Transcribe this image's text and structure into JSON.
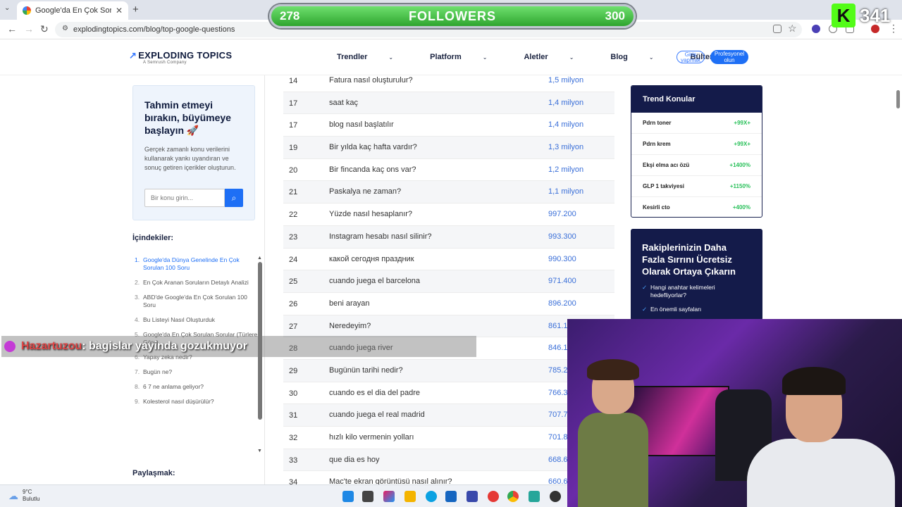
{
  "browser": {
    "tab_title": "Google'da En Çok Sorulan 100",
    "url": "explodingtopics.com/blog/top-google-questions"
  },
  "overlay": {
    "followers_current": "278",
    "followers_label": "FOLLOWERS",
    "followers_goal": "300",
    "kick_logo": "K",
    "kick_count": "341"
  },
  "site": {
    "logo": "EXPLODING TOPICS",
    "logo_sub": "A Semrush Company",
    "nav": [
      "Trendler",
      "Platform",
      "Aletler",
      "Blog",
      "Bülten"
    ],
    "login": "Giriş yapmak",
    "pro": "Profesyonel olun"
  },
  "promo": {
    "title": "Tahmin etmeyi bırakın, büyümeye başlayın 🚀",
    "text": "Gerçek zamanlı konu verilerini kullanarak yankı uyandıran ve sonuç getiren içerikler oluşturun.",
    "search_placeholder": "Bir konu girin..."
  },
  "toc": {
    "title": "İçindekiler:",
    "items": [
      {
        "num": "1.",
        "label": "Google'da Dünya Genelinde En Çok Sorulan 100 Soru"
      },
      {
        "num": "2.",
        "label": "En Çok Aranan Soruların Detaylı Analizi"
      },
      {
        "num": "3.",
        "label": "ABD'de Google'da En Çok Sorulan 100 Soru"
      },
      {
        "num": "4.",
        "label": "Bu Listeyi Nasıl Oluşturduk"
      },
      {
        "num": "5.",
        "label": "Google'da En Çok Sorulan Sorular (Türlere Göre)"
      },
      {
        "num": "6.",
        "label": "Yapay zeka nedir?"
      },
      {
        "num": "7.",
        "label": "Bugün ne?"
      },
      {
        "num": "8.",
        "label": "6 7 ne anlama geliyor?"
      },
      {
        "num": "9.",
        "label": "Kolesterol nasıl düşürülür?"
      }
    ],
    "share": "Paylaşmak:"
  },
  "table": {
    "rows": [
      {
        "rank": "14",
        "q": "Fatura nasıl oluşturulur?",
        "v": "1,5 milyon"
      },
      {
        "rank": "17",
        "q": "saat kaç",
        "v": "1,4 milyon"
      },
      {
        "rank": "17",
        "q": "blog nasıl başlatılır",
        "v": "1,4 milyon"
      },
      {
        "rank": "19",
        "q": "Bir yılda kaç hafta vardır?",
        "v": "1,3 milyon"
      },
      {
        "rank": "20",
        "q": "Bir fincanda kaç ons var?",
        "v": "1,2 milyon"
      },
      {
        "rank": "21",
        "q": "Paskalya ne zaman?",
        "v": "1,1 milyon"
      },
      {
        "rank": "22",
        "q": "Yüzde nasıl hesaplanır?",
        "v": "997.200"
      },
      {
        "rank": "23",
        "q": "Instagram hesabı nasıl silinir?",
        "v": "993.300"
      },
      {
        "rank": "24",
        "q": "какой сегодня праздник",
        "v": "990.300"
      },
      {
        "rank": "25",
        "q": "cuando juega el barcelona",
        "v": "971.400"
      },
      {
        "rank": "26",
        "q": "beni arayan",
        "v": "896.200"
      },
      {
        "rank": "27",
        "q": "Neredeyim?",
        "v": "861.10"
      },
      {
        "rank": "28",
        "q": "cuando juega river",
        "v": "846.10"
      },
      {
        "rank": "29",
        "q": "Bugünün tarihi nedir?",
        "v": "785.2"
      },
      {
        "rank": "30",
        "q": "cuando es el dia del padre",
        "v": "766.3"
      },
      {
        "rank": "31",
        "q": "cuando juega el real madrid",
        "v": "707.7"
      },
      {
        "rank": "32",
        "q": "hızlı kilo vermenin yolları",
        "v": "701.8"
      },
      {
        "rank": "33",
        "q": "que dia es hoy",
        "v": "668.6"
      },
      {
        "rank": "34",
        "q": "Mac'te ekran görüntüsü nasıl alınır?",
        "v": "660.6"
      }
    ]
  },
  "trend": {
    "title": "Trend Konular",
    "rows": [
      {
        "name": "Pdrn toner",
        "val": "+99X+"
      },
      {
        "name": "Pdrn krem",
        "val": "+99X+"
      },
      {
        "name": "Ekşi elma acı özü",
        "val": "+1400%"
      },
      {
        "name": "GLP 1 takviyesi",
        "val": "+1150%"
      },
      {
        "name": "Kesirli cto",
        "val": "+400%"
      }
    ]
  },
  "competitor": {
    "title": "Rakiplerinizin Daha Fazla Sırrını Ücretsiz Olarak Ortaya Çıkarın",
    "bullets": [
      "Hangi anahtar kelimeleri hedefliyorlar?",
      "En önemli sayfaları"
    ]
  },
  "chat": {
    "user": "Hazartuzou",
    "message": " : bagislar yayinda gozukmuyor"
  },
  "taskbar": {
    "temp": "9°C",
    "condition": "Bulutlu"
  }
}
